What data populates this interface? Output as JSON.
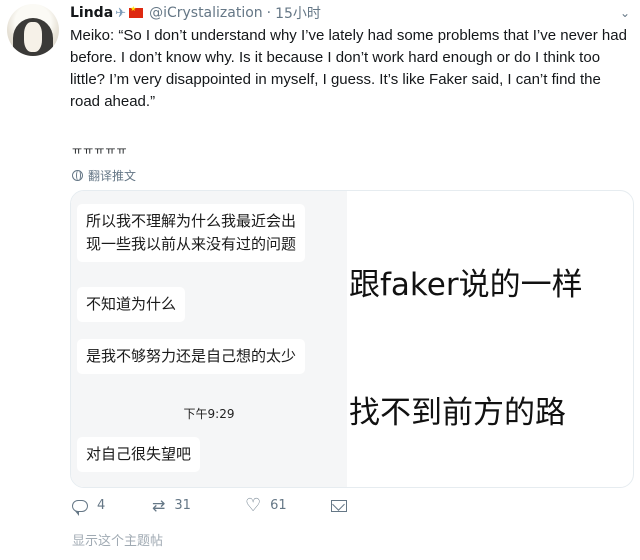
{
  "tweet": {
    "display_name": "Linda",
    "name_emoji": "✈",
    "handle": "@iCrystalization",
    "separator": "·",
    "time": "15小时",
    "text": "Meiko: “So I don’t understand why I’ve lately had some problems that I’ve never had before. I don’t know why. Is it because I don’t work hard enough or do I think too little? I’m very disappointed in myself, I guess. It’s like Faker said, I can’t find the road ahead.”",
    "reaction_text": "ㅠㅠㅠㅠㅠ",
    "translate_label": "翻译推文",
    "show_thread": "显示这个主题帖"
  },
  "media": {
    "chat_bubbles": [
      {
        "text": "所以我不理解为什么我最近会出\n现一些我以前从来没有过的问题"
      },
      {
        "text": "不知道为什么"
      },
      {
        "text": "是我不够努力还是自己想的太少"
      },
      {
        "text": "对自己很失望吧"
      }
    ],
    "chat_timestamp": "下午9:29",
    "caption_top": "跟faker说的一样",
    "caption_bottom": "找不到前方的路"
  },
  "actions": {
    "reply_count": "4",
    "retweet_count": "31",
    "like_count": "61"
  },
  "colors": {
    "muted_text": "#657786",
    "flag_red": "#de2910"
  }
}
